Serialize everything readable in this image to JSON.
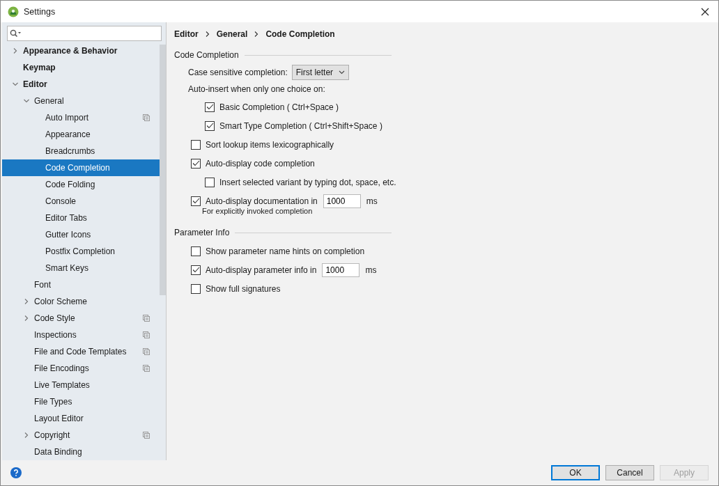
{
  "window": {
    "title": "Settings"
  },
  "tree": [
    {
      "label": "Appearance & Behavior",
      "expanded": false,
      "selected": false,
      "scoped": false
    },
    {
      "label": "Keymap",
      "selected": false,
      "scoped": false
    },
    {
      "label": "Editor",
      "expanded": true,
      "selected": false,
      "scoped": false,
      "children": [
        {
          "label": "General",
          "expanded": true,
          "selected": false,
          "scoped": false,
          "children": [
            {
              "label": "Auto Import",
              "selected": false,
              "scoped": true
            },
            {
              "label": "Appearance",
              "selected": false,
              "scoped": false
            },
            {
              "label": "Breadcrumbs",
              "selected": false,
              "scoped": false
            },
            {
              "label": "Code Completion",
              "selected": true,
              "scoped": false
            },
            {
              "label": "Code Folding",
              "selected": false,
              "scoped": false
            },
            {
              "label": "Console",
              "selected": false,
              "scoped": false
            },
            {
              "label": "Editor Tabs",
              "selected": false,
              "scoped": false
            },
            {
              "label": "Gutter Icons",
              "selected": false,
              "scoped": false
            },
            {
              "label": "Postfix Completion",
              "selected": false,
              "scoped": false
            },
            {
              "label": "Smart Keys",
              "selected": false,
              "scoped": false
            }
          ]
        },
        {
          "label": "Font",
          "selected": false,
          "scoped": false
        },
        {
          "label": "Color Scheme",
          "expanded": false,
          "selected": false,
          "scoped": false
        },
        {
          "label": "Code Style",
          "expanded": false,
          "selected": false,
          "scoped": true
        },
        {
          "label": "Inspections",
          "selected": false,
          "scoped": true
        },
        {
          "label": "File and Code Templates",
          "selected": false,
          "scoped": true
        },
        {
          "label": "File Encodings",
          "selected": false,
          "scoped": true
        },
        {
          "label": "Live Templates",
          "selected": false,
          "scoped": false
        },
        {
          "label": "File Types",
          "selected": false,
          "scoped": false
        },
        {
          "label": "Layout Editor",
          "selected": false,
          "scoped": false
        },
        {
          "label": "Copyright",
          "expanded": false,
          "selected": false,
          "scoped": true
        },
        {
          "label": "Data Binding",
          "selected": false,
          "scoped": false
        }
      ]
    }
  ],
  "breadcrumbs": [
    "Editor",
    "General",
    "Code Completion"
  ],
  "sections": [
    {
      "title": "Code Completion",
      "items": [
        {
          "kind": "dropdown",
          "label": "Case sensitive completion:",
          "value": "First letter"
        },
        {
          "kind": "label",
          "label": "Auto-insert when only one choice on:",
          "children": [
            {
              "kind": "checkbox",
              "label": "Basic Completion ( Ctrl+Space )",
              "checked": true
            },
            {
              "kind": "checkbox",
              "label": "Smart Type Completion ( Ctrl+Shift+Space )",
              "checked": true
            }
          ]
        },
        {
          "kind": "checkbox",
          "label": "Sort lookup items lexicographically",
          "checked": false
        },
        {
          "kind": "checkbox",
          "label": "Auto-display code completion",
          "checked": true,
          "children": [
            {
              "kind": "checkbox",
              "label": "Insert selected variant by typing dot, space, etc.",
              "checked": false
            }
          ]
        },
        {
          "kind": "checkbox_field",
          "label": "Auto-display documentation in",
          "checked": true,
          "value": "1000",
          "unit": "ms",
          "note": "For explicitly invoked completion"
        }
      ]
    },
    {
      "title": "Parameter Info",
      "items": [
        {
          "kind": "checkbox",
          "label": "Show parameter name hints on completion",
          "checked": false
        },
        {
          "kind": "checkbox_field",
          "label": "Auto-display parameter info in",
          "checked": true,
          "value": "1000",
          "unit": "ms"
        },
        {
          "kind": "checkbox",
          "label": "Show full signatures",
          "checked": false
        }
      ]
    }
  ],
  "buttons": [
    {
      "label": "OK",
      "kind": "default"
    },
    {
      "label": "Cancel",
      "kind": "normal"
    },
    {
      "label": "Apply",
      "kind": "disabled"
    }
  ]
}
